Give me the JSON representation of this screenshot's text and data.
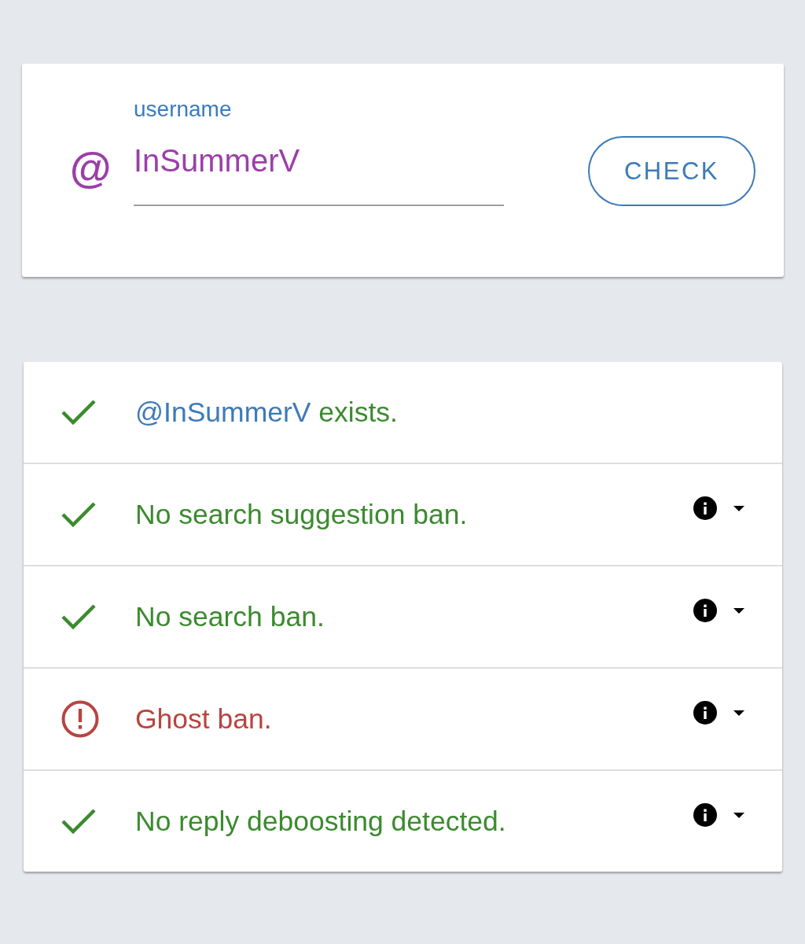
{
  "username_field": {
    "prefix": "@",
    "label": "username",
    "value": "InSummerV"
  },
  "check_button": {
    "label": "CHECK"
  },
  "results": [
    {
      "passed": true,
      "handle": "@InSummerV",
      "text": "exists.",
      "expandable": false
    },
    {
      "passed": true,
      "text": "No search suggestion ban.",
      "expandable": true,
      "expanded": false
    },
    {
      "passed": true,
      "text": "No search ban.",
      "expandable": true,
      "expanded": false
    },
    {
      "passed": false,
      "text": "Ghost ban.",
      "expandable": true,
      "expanded": false
    },
    {
      "passed": true,
      "text": "No reply deboosting detected.",
      "expandable": true,
      "expanded": false
    }
  ]
}
